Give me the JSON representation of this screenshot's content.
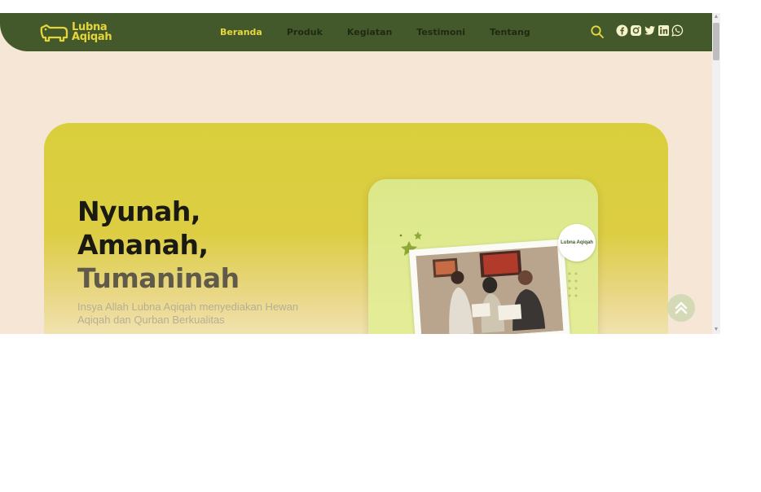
{
  "brand": {
    "line1": "Lubna",
    "line2": "Aqiqah"
  },
  "nav": {
    "items": [
      {
        "label": "Beranda",
        "active": true
      },
      {
        "label": "Produk",
        "active": false
      },
      {
        "label": "Kegiatan",
        "active": false
      },
      {
        "label": "Testimoni",
        "active": false
      },
      {
        "label": "Tentang",
        "active": false
      }
    ]
  },
  "header_icons": [
    "search-icon",
    "facebook-icon",
    "instagram-icon",
    "twitter-icon",
    "linkedin-icon",
    "whatsapp-icon"
  ],
  "hero": {
    "line1": "Nyunah,",
    "line2": "Amanah,",
    "line3": "Tumaninah",
    "subtitle": "Insya Allah Lubna Aqiqah menyediakan Hewan Aqiqah dan Qurban Berkualitas",
    "badge_text": "Lubna Aqiqah"
  },
  "colors": {
    "header_bg": "#44592b",
    "accent": "#e7d83d",
    "page_bg": "#f5e6d5",
    "hero_bg": "#d9cf3c"
  }
}
